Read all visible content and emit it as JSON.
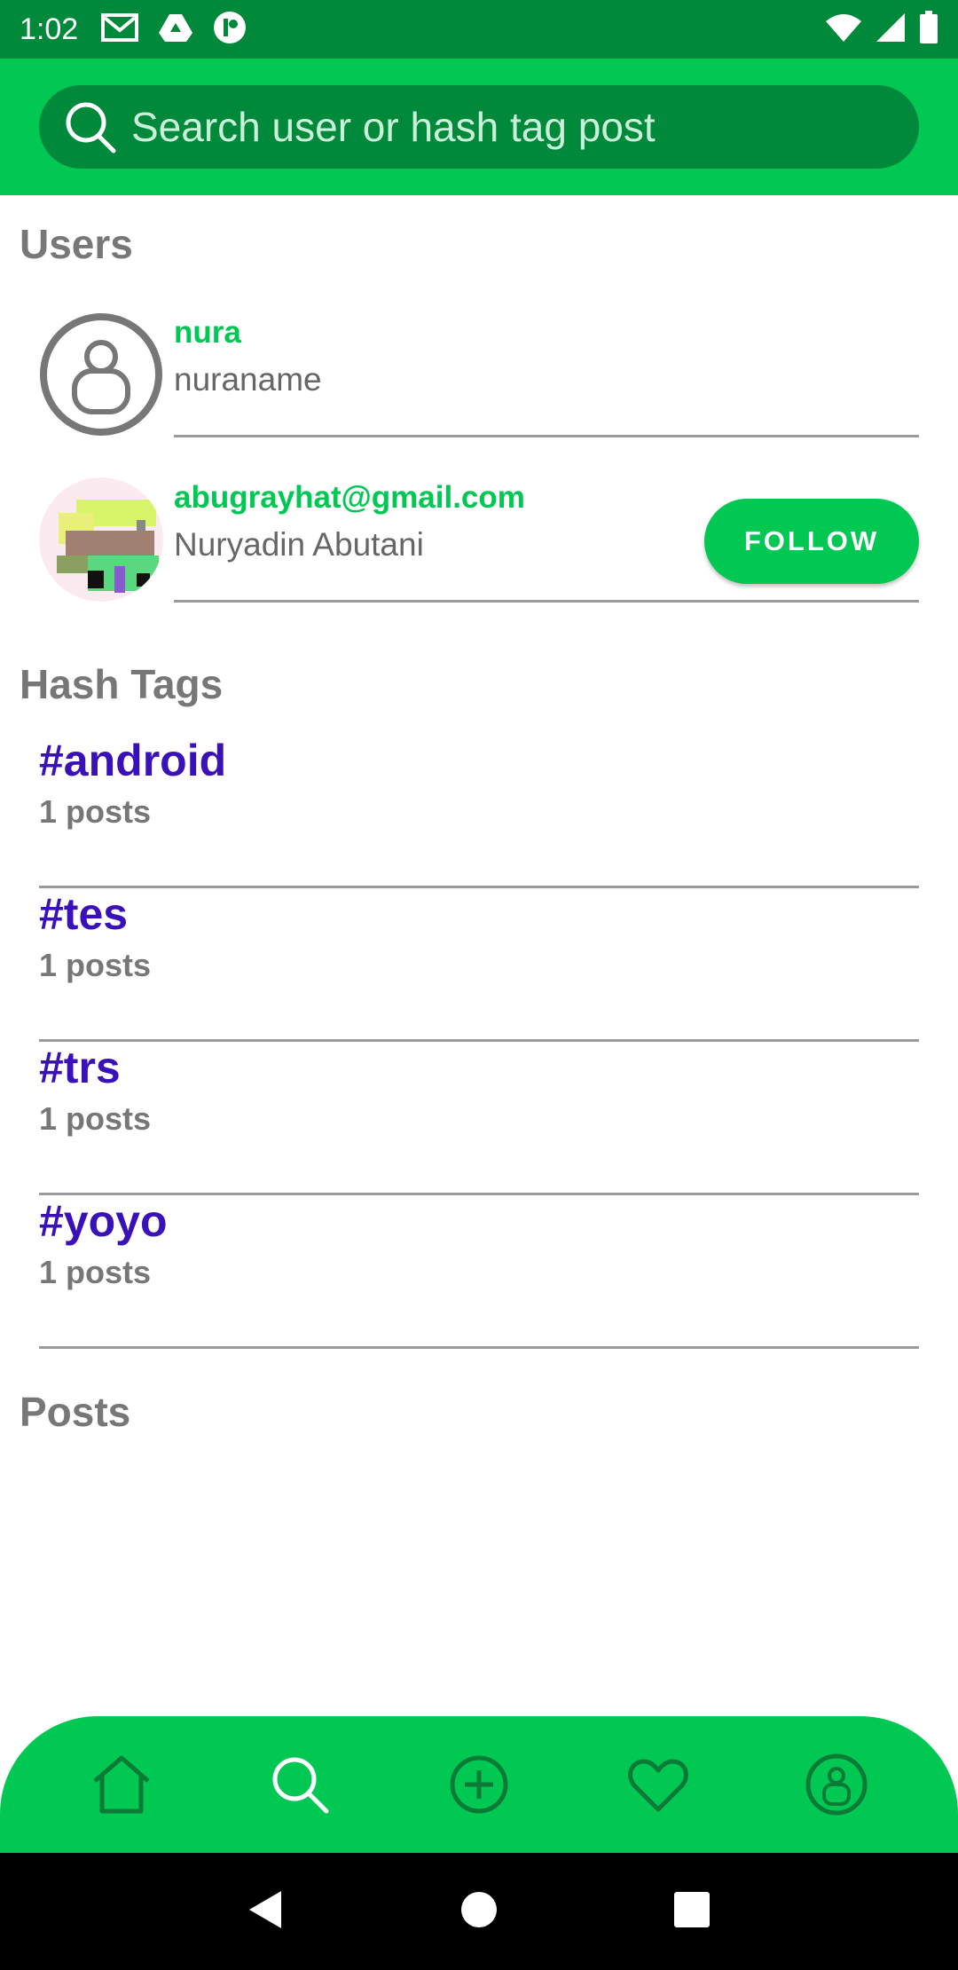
{
  "status_bar": {
    "time": "1:02",
    "left_icons": [
      "gmail-icon",
      "drive-icon",
      "app-icon"
    ],
    "right_icons": [
      "wifi-icon",
      "signal-icon",
      "battery-icon"
    ]
  },
  "search": {
    "placeholder": "Search user or hash tag post",
    "value": ""
  },
  "users_section": {
    "title": "Users",
    "items": [
      {
        "handle": "nura",
        "name": "nuraname",
        "avatar": "default-avatar-icon",
        "button": ""
      },
      {
        "handle": "abugrayhat@gmail.com",
        "name": "Nuryadin Abutani",
        "avatar": "photo-avatar",
        "button": "FOLLOW"
      }
    ]
  },
  "hashtags_section": {
    "title": "Hash Tags",
    "items": [
      {
        "tag": "#android",
        "count": "1 posts"
      },
      {
        "tag": "#tes",
        "count": "1 posts"
      },
      {
        "tag": "#trs",
        "count": "1 posts"
      },
      {
        "tag": "#yoyo",
        "count": "1 posts"
      }
    ]
  },
  "posts_section": {
    "title": "Posts"
  },
  "bottom_nav": {
    "items": [
      "home-icon",
      "search-icon",
      "add-icon",
      "heart-icon",
      "profile-icon"
    ],
    "active": "search-icon"
  },
  "system_nav": [
    "back-icon",
    "home-circle-icon",
    "recents-icon"
  ],
  "colors": {
    "primary": "#00c853",
    "primary_dark": "#00893a",
    "hashtag": "#3a10b8",
    "secondary_text": "#777777"
  }
}
